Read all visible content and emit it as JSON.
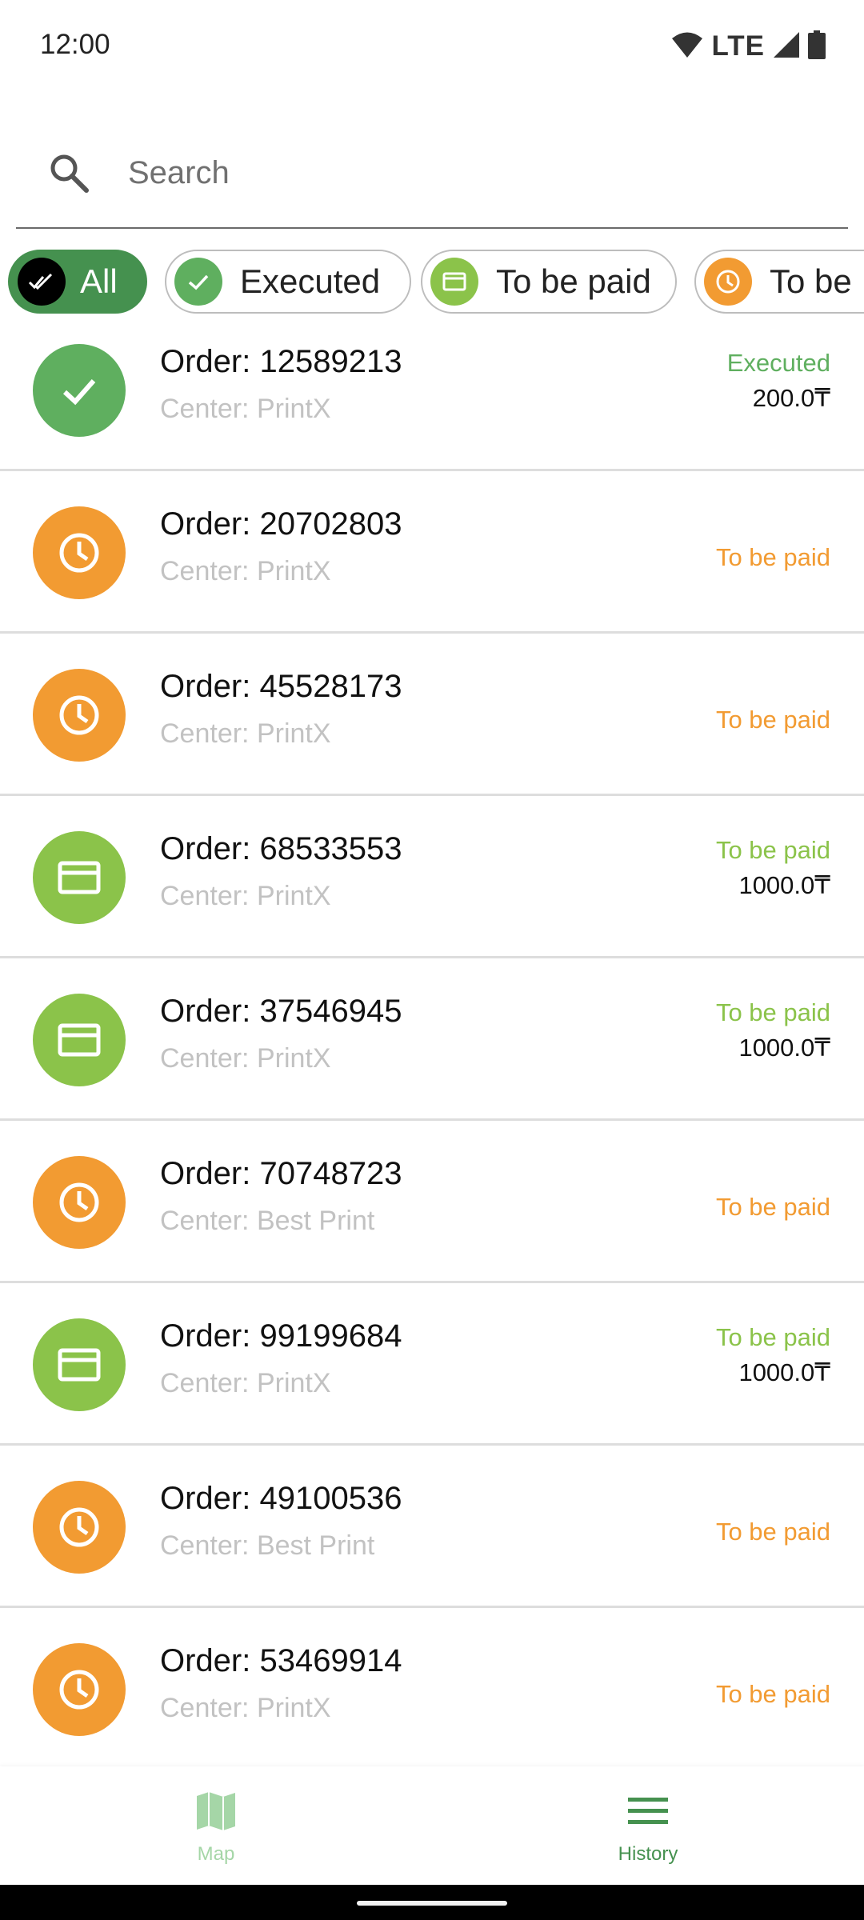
{
  "status_bar": {
    "time": "12:00",
    "network": "LTE"
  },
  "search": {
    "placeholder": "Search"
  },
  "filters": [
    {
      "label": "All",
      "icon": "double-check-icon",
      "active": true
    },
    {
      "label": "Executed",
      "icon": "check-icon",
      "active": false
    },
    {
      "label": "To be paid",
      "icon": "card-icon",
      "active": false
    },
    {
      "label": "To be",
      "icon": "clock-icon",
      "active": false
    }
  ],
  "colors": {
    "executed": "#5faf5f",
    "to_be_paid_card": "#8bc34a",
    "to_be_paid_clock": "#f29b32",
    "accent": "#45914f"
  },
  "orders": [
    {
      "title": "Order: 12589213",
      "center": "Center: PrintX",
      "status": "Executed",
      "status_kind": "executed",
      "price": "200.0₸",
      "icon": "check-icon"
    },
    {
      "title": "Order: 20702803",
      "center": "Center: PrintX",
      "status": "To be paid",
      "status_kind": "clock",
      "price": "",
      "icon": "clock-icon"
    },
    {
      "title": "Order: 45528173",
      "center": "Center: PrintX",
      "status": "To be paid",
      "status_kind": "clock",
      "price": "",
      "icon": "clock-icon"
    },
    {
      "title": "Order: 68533553",
      "center": "Center: PrintX",
      "status": "To be paid",
      "status_kind": "card",
      "price": "1000.0₸",
      "icon": "card-icon"
    },
    {
      "title": "Order: 37546945",
      "center": "Center: PrintX",
      "status": "To be paid",
      "status_kind": "card",
      "price": "1000.0₸",
      "icon": "card-icon"
    },
    {
      "title": "Order: 70748723",
      "center": "Center: Best Print",
      "status": "To be paid",
      "status_kind": "clock",
      "price": "",
      "icon": "clock-icon"
    },
    {
      "title": "Order: 99199684",
      "center": "Center: PrintX",
      "status": "To be paid",
      "status_kind": "card",
      "price": "1000.0₸",
      "icon": "card-icon"
    },
    {
      "title": "Order: 49100536",
      "center": "Center: Best Print",
      "status": "To be paid",
      "status_kind": "clock",
      "price": "",
      "icon": "clock-icon"
    },
    {
      "title": "Order: 53469914",
      "center": "Center: PrintX",
      "status": "To be paid",
      "status_kind": "clock",
      "price": "",
      "icon": "clock-icon"
    }
  ],
  "bottom_nav": [
    {
      "label": "Map",
      "icon": "map-icon",
      "active": false
    },
    {
      "label": "History",
      "icon": "menu-icon",
      "active": true
    }
  ]
}
